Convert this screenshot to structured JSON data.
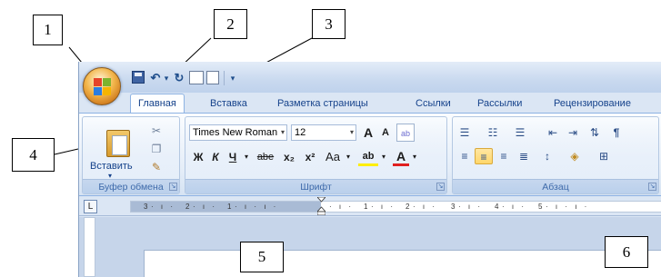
{
  "callouts": [
    "1",
    "2",
    "3",
    "4",
    "5",
    "6"
  ],
  "quick_access": {
    "icons": [
      "save-icon",
      "undo-icon",
      "redo-icon",
      "print-preview-icon",
      "new-document-icon"
    ],
    "undo_glyph": "↶",
    "redo_glyph": "↻",
    "dropdown_glyph": "▾"
  },
  "tabs": [
    "Главная",
    "Вставка",
    "Разметка страницы",
    "Ссылки",
    "Рассылки",
    "Рецензирование"
  ],
  "groups": {
    "clipboard": {
      "label": "Буфер обмена",
      "paste": "Вставить"
    },
    "font": {
      "label": "Шрифт",
      "font_name": "Times New Roman",
      "font_size": "12",
      "grow": "A",
      "shrink": "A",
      "bold": "Ж",
      "italic": "К",
      "underline": "Ч",
      "strike": "abe",
      "subscript": "x₂",
      "superscript": "x²",
      "change_case": "Aa",
      "highlight": "ab",
      "font_color": "A"
    },
    "paragraph": {
      "label": "Абзац"
    }
  },
  "ruler": {
    "ticks": [
      "3",
      "2",
      "1",
      "1",
      "2",
      "3",
      "4",
      "5"
    ],
    "tab_selector": "L"
  },
  "colors": {
    "highlight": "#ffee00",
    "font_color": "#e02020",
    "accent": "#15428b"
  }
}
